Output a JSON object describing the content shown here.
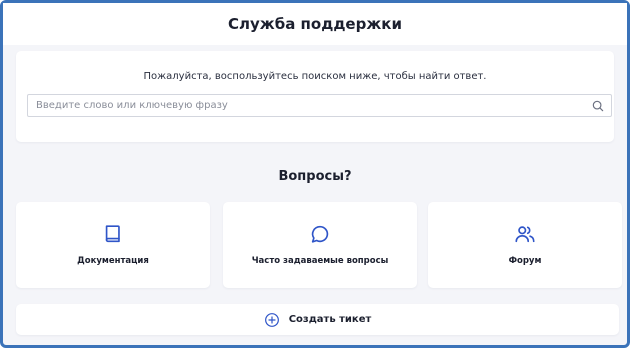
{
  "header": {
    "title": "Служба поддержки"
  },
  "search": {
    "prompt": "Пожалуйста, воспользуйтесь поиском ниже, чтобы найти ответ.",
    "placeholder": "Введите слово или ключевую фразу",
    "value": "",
    "icon": "search-icon"
  },
  "questions": {
    "title": "Вопросы?",
    "cards": [
      {
        "label": "Документация",
        "icon": "book-icon"
      },
      {
        "label": "Часто задаваемые вопросы",
        "icon": "chat-bubble-icon"
      },
      {
        "label": "Форум",
        "icon": "users-icon"
      }
    ]
  },
  "ticket": {
    "label": "Создать тикет",
    "icon": "plus-circle-icon"
  },
  "colors": {
    "accent": "#2f55c8",
    "frame_border": "#3b73b9",
    "background": "#f4f5f9"
  }
}
